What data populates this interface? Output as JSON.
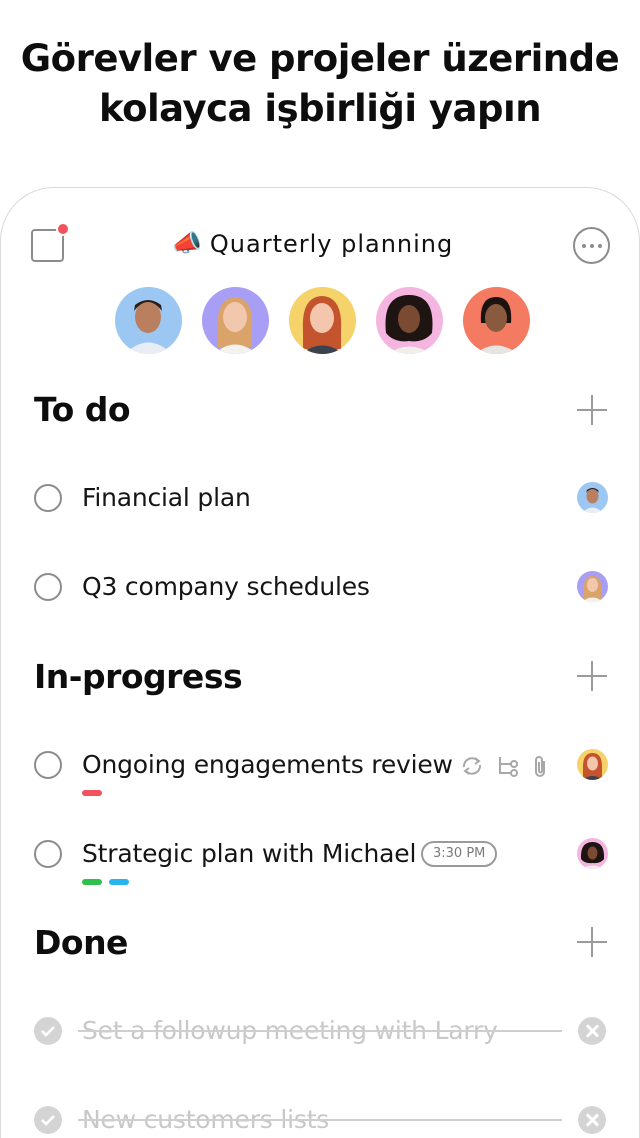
{
  "headline": {
    "line1": "Görevler ve projeler üzerinde",
    "line2": "kolayca işbirliği yapın"
  },
  "project": {
    "emoji": "📣",
    "title": "Quarterly planning"
  },
  "colors": {
    "notification": "#f0525e",
    "tag_red": "#f0525e",
    "tag_green": "#2fbf4f",
    "tag_blue": "#27b5f0"
  },
  "sections": {
    "todo": {
      "title": "To do",
      "tasks": [
        "Financial plan",
        "Q3 company schedules"
      ]
    },
    "in_progress": {
      "title": "In-progress",
      "tasks": [
        "Ongoing engagements review",
        "Strategic plan with Michael"
      ],
      "time_chip": "3:30 PM"
    },
    "done": {
      "title": "Done",
      "tasks": [
        "Set a followup meeting with Larry",
        "New customers lists"
      ]
    }
  },
  "icons": [
    "inbox-icon",
    "more-icon",
    "add-icon",
    "repeat-icon",
    "subtask-icon",
    "attachment-icon",
    "check-icon",
    "remove-icon"
  ]
}
